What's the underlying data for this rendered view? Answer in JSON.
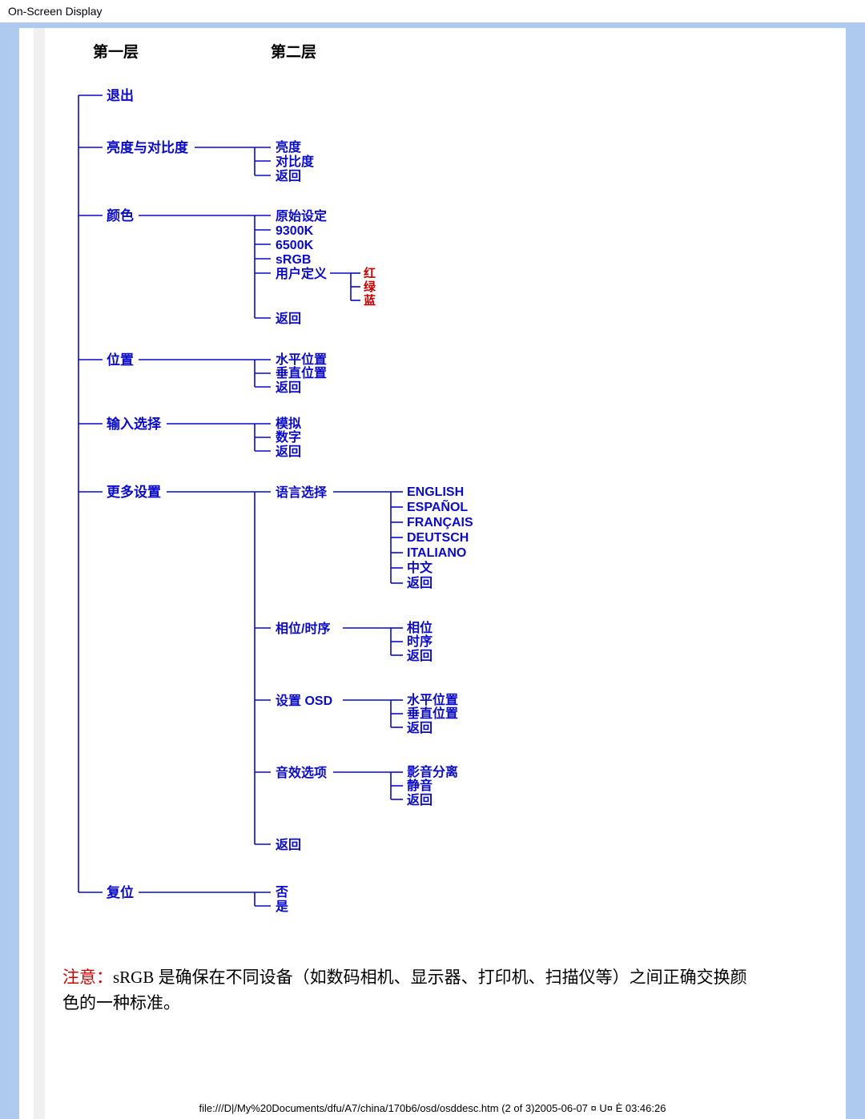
{
  "title": "On-Screen Display",
  "headers": {
    "col1": "第一层",
    "col2": "第二层"
  },
  "level1": {
    "exit": "退出",
    "brightcontrast": "亮度与对比度",
    "color": "颜色",
    "position": "位置",
    "input": "输入选择",
    "more": "更多设置",
    "reset": "复位"
  },
  "bc": {
    "brightness": "亮度",
    "contrast": "对比度",
    "back": "返回"
  },
  "color": {
    "original": "原始设定",
    "k9300": "9300K",
    "k6500": "6500K",
    "srgb": "sRGB",
    "user": "用户定义",
    "back": "返回",
    "rgb": {
      "r": "红",
      "g": "绿",
      "b": "蓝"
    }
  },
  "pos": {
    "h": "水平位置",
    "v": "垂直位置",
    "back": "返回"
  },
  "input": {
    "analog": "模拟",
    "digital": "数字",
    "back": "返回"
  },
  "more": {
    "language": "语言选择",
    "phase": "相位/时序",
    "osd": "设置  OSD",
    "audio": "音效选项",
    "back": "返回",
    "languages": {
      "en": "ENGLISH",
      "es": "ESPAÑOL",
      "fr": "FRANÇAIS",
      "de": "DEUTSCH",
      "it": "ITALIANO",
      "zh": "中文",
      "back": "返回"
    },
    "phase_sub": {
      "phase": "相位",
      "clock": "时序",
      "back": "返回"
    },
    "osd_sub": {
      "h": "水平位置",
      "v": "垂直位置",
      "back": "返回"
    },
    "audio_sub": {
      "sep": "影音分离",
      "mute": "静音",
      "back": "返回"
    }
  },
  "reset": {
    "no": "否",
    "yes": "是"
  },
  "note": {
    "label": "注意：",
    "body": "sRGB 是确保在不同设备（如数码相机、显示器、打印机、扫描仪等）之间正确交换颜色的一种标准。"
  },
  "footer": "file:///D|/My%20Documents/dfu/A7/china/170b6/osd/osddesc.htm (2 of 3)2005-06-07 ¤ U¤ È 03:46:26"
}
